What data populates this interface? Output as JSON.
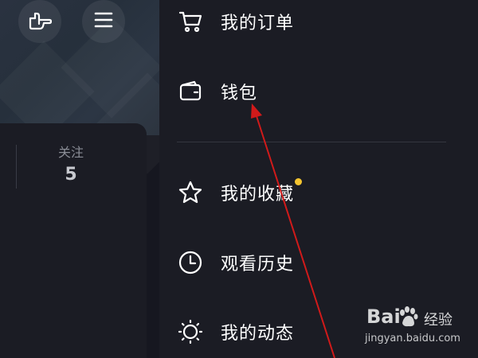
{
  "profile": {
    "stat_label": "关注",
    "stat_value": "5"
  },
  "menu": {
    "items": [
      {
        "label": "我的订单",
        "icon": "cart-icon"
      },
      {
        "label": "钱包",
        "icon": "wallet-icon"
      },
      {
        "label": "我的收藏",
        "icon": "star-icon",
        "badge": "dot"
      },
      {
        "label": "观看历史",
        "icon": "clock-icon"
      },
      {
        "label": "我的动态",
        "icon": "sun-icon"
      }
    ]
  },
  "watermark": {
    "logo_left": "Bai",
    "logo_right": "经验",
    "url": "jingyan.baidu.com"
  },
  "colors": {
    "background": "#1b1c24",
    "arrow": "#d11a1a",
    "badge": "#f4c430"
  }
}
